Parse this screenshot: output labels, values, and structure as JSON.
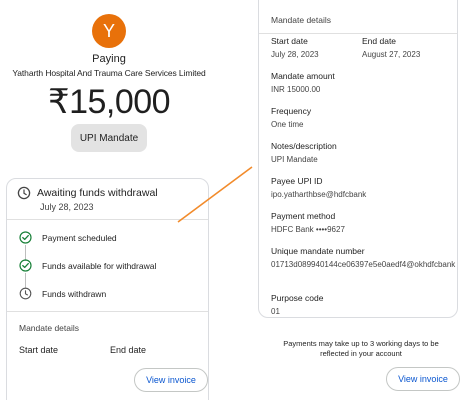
{
  "payment": {
    "avatar_letter": "Y",
    "paying_label": "Paying",
    "merchant": "Yatharth Hospital And Trauma Care Services Limited",
    "amount": "₹15,000",
    "chip_label": "UPI Mandate"
  },
  "status": {
    "title": "Awaiting funds withdrawal",
    "date": "July 28, 2023",
    "steps": [
      {
        "label": "Payment scheduled",
        "state": "done"
      },
      {
        "label": "Funds available for withdrawal",
        "state": "done"
      },
      {
        "label": "Funds withdrawn",
        "state": "pending"
      }
    ]
  },
  "left_details": {
    "title": "Mandate details",
    "start_label": "Start date",
    "end_label": "End date"
  },
  "mandate_details": {
    "title": "Mandate details",
    "start_label": "Start date",
    "start_value": "July 28, 2023",
    "end_label": "End date",
    "end_value": "August 27, 2023",
    "amount_label": "Mandate amount",
    "amount_value": "INR 15000.00",
    "frequency_label": "Frequency",
    "frequency_value": "One time",
    "notes_label": "Notes/description",
    "notes_value": "UPI Mandate",
    "payee_label": "Payee UPI ID",
    "payee_value": "ipo.yatharthbse@hdfcbank",
    "method_label": "Payment method",
    "method_value": "HDFC Bank ••••9627",
    "umn_label": "Unique mandate number",
    "umn_value": "01713d089940144ce06397e5e0aedf4@okhdfcbank",
    "purpose_label": "Purpose code",
    "purpose_value": "01"
  },
  "notice": "Payments may take up to 3 working days to be reflected in your account",
  "buttons": {
    "view_invoice": "View invoice"
  },
  "colors": {
    "avatar": "#e8710a",
    "success": "#188038",
    "link": "#0b57d0",
    "connector": "#f28b2b"
  },
  "icons": {
    "clock": "clock-icon",
    "check": "check-circle-icon"
  }
}
